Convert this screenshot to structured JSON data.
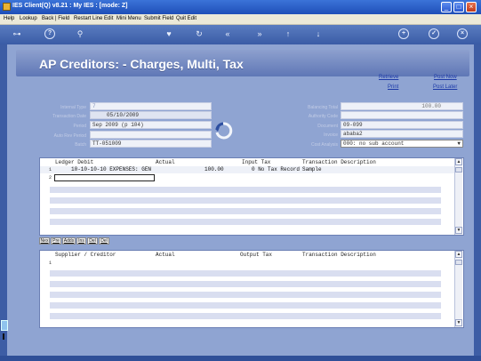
{
  "window": {
    "title": "IES Client(Q) v8.21 : My IES :       [mode: Z]"
  },
  "menu": [
    "Help",
    "Lookup",
    "Back | Field",
    "Restart Line Edit",
    "Mini Menu",
    "Submit Field",
    "Quit Edit"
  ],
  "toolbar": {
    "icons": [
      "key-icon",
      "info-icon",
      "search-icon",
      "heart-icon",
      "refresh-icon",
      "back-icon",
      "forward-icon",
      "up-icon",
      "down-icon",
      "plus-icon",
      "check-icon",
      "close-icon"
    ]
  },
  "header": {
    "title": "AP Creditors: - Charges, Multi, Tax"
  },
  "links": {
    "retrieve": "Retrieve",
    "post_now": "Post Now",
    "print": "Print",
    "post_later": "Post Later"
  },
  "form_left": {
    "internal_type": {
      "label": "Internal Type",
      "value": "7"
    },
    "transaction_date": {
      "label": "Transaction Date",
      "value": "05/10/2009"
    },
    "period": {
      "label": "Period",
      "value": "Sep 2009 (p 104)"
    },
    "auto_rev_period": {
      "label": "Auto Rev Period",
      "value": ""
    },
    "batch": {
      "label": "Batch",
      "value": "TT-051009"
    }
  },
  "form_right": {
    "balancing_total": {
      "label": "Balancing Total",
      "value": "100.00"
    },
    "authority_code": {
      "label": "Authority Code",
      "value": ""
    },
    "document": {
      "label": "Document",
      "value": "09-099"
    },
    "invoice": {
      "label": "Invoice",
      "value": "ababa2"
    },
    "cost_analysis": {
      "label": "Cost Analysis",
      "value": "000: no sub account"
    }
  },
  "grid1": {
    "headers": [
      "Ledger Debit",
      "Actual",
      "Input Tax",
      "Transaction Description"
    ],
    "rows": [
      {
        "num": "1",
        "ledger": "10-10-10-10 EXPENSES: GEN",
        "actual": "100.00",
        "tax": "0 No Tax Record",
        "desc": "Sample"
      },
      {
        "num": "2",
        "ledger": "",
        "actual": "",
        "tax": "",
        "desc": ""
      }
    ]
  },
  "mini_buttons": [
    "Nex",
    "Pre",
    "Adds",
    "Ins",
    "Del",
    "Del"
  ],
  "grid2": {
    "headers": [
      "Supplier / Creditor",
      "Actual",
      "Output Tax",
      "Transaction Description"
    ],
    "rows": [
      {
        "num": "1"
      }
    ]
  }
}
